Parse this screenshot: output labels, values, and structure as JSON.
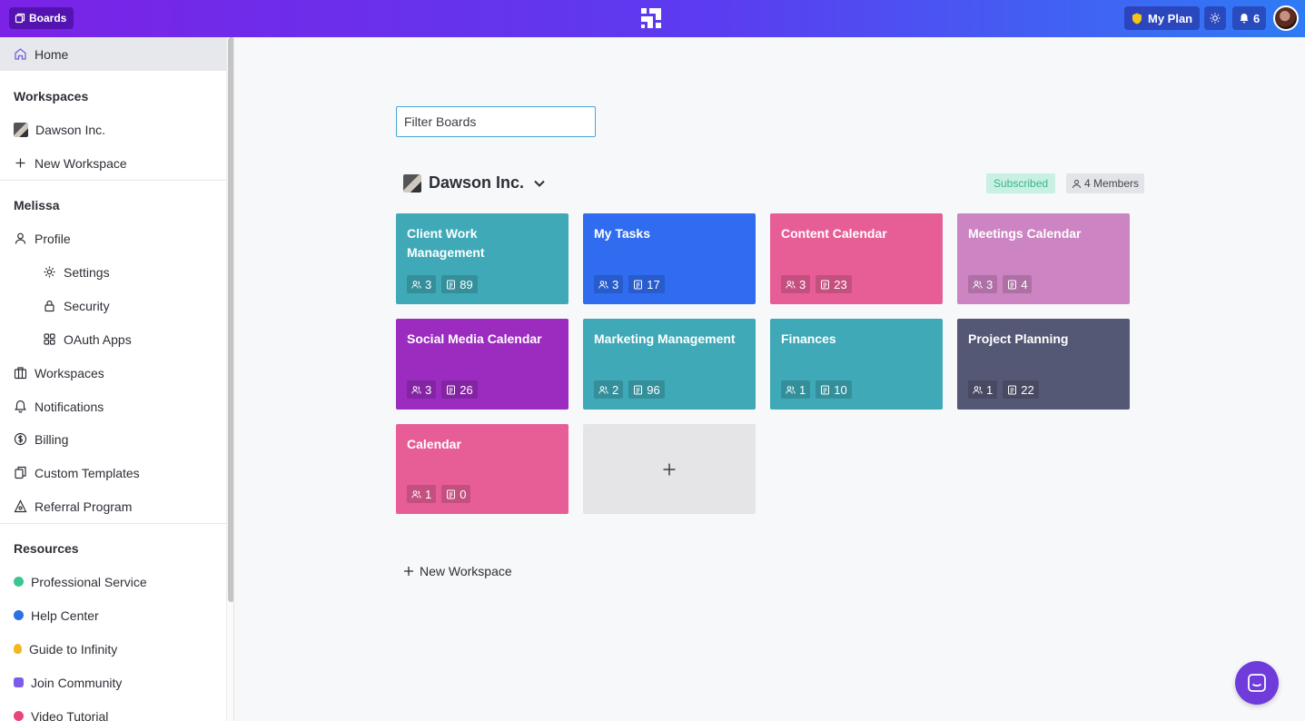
{
  "topbar": {
    "boards_label": "Boards",
    "plan_label": "My Plan",
    "notifications_count": "6"
  },
  "sidebar": {
    "home": "Home",
    "workspaces_heading": "Workspaces",
    "workspace_item": "Dawson Inc.",
    "new_workspace": "New Workspace",
    "user_heading": "Melissa",
    "profile": "Profile",
    "settings": "Settings",
    "security": "Security",
    "oauth_apps": "OAuth Apps",
    "workspaces": "Workspaces",
    "notifications": "Notifications",
    "billing": "Billing",
    "custom_templates": "Custom Templates",
    "referral_program": "Referral Program",
    "resources_heading": "Resources",
    "resources": [
      {
        "label": "Professional Service",
        "color": "#3cc58f"
      },
      {
        "label": "Help Center",
        "color": "#2f6fe4"
      },
      {
        "label": "Guide to Infinity",
        "color": "#f2b821"
      },
      {
        "label": "Join Community",
        "color": "#7c5ce8"
      },
      {
        "label": "Video Tutorial",
        "color": "#e8457a"
      }
    ]
  },
  "main": {
    "filter_placeholder": "Filter Boards",
    "workspace_title": "Dawson Inc.",
    "subscribed_label": "Subscribed",
    "members_label": "4 Members",
    "new_workspace": "New Workspace",
    "boards": [
      {
        "title": "Client Work Management",
        "members": "3",
        "items": "89",
        "color": "#3fa9b7"
      },
      {
        "title": "My Tasks",
        "members": "3",
        "items": "17",
        "color": "#2f6cf0"
      },
      {
        "title": "Content Calendar",
        "members": "3",
        "items": "23",
        "color": "#e75e96"
      },
      {
        "title": "Meetings Calendar",
        "members": "3",
        "items": "4",
        "color": "#cd84c2"
      },
      {
        "title": "Social Media Calendar",
        "members": "3",
        "items": "26",
        "color": "#9b2cbf"
      },
      {
        "title": "Marketing Management",
        "members": "2",
        "items": "96",
        "color": "#3fa9b7"
      },
      {
        "title": "Finances",
        "members": "1",
        "items": "10",
        "color": "#3fa9b7"
      },
      {
        "title": "Project Planning",
        "members": "1",
        "items": "22",
        "color": "#555874"
      },
      {
        "title": "Calendar",
        "members": "1",
        "items": "0",
        "color": "#e75e96"
      }
    ]
  }
}
